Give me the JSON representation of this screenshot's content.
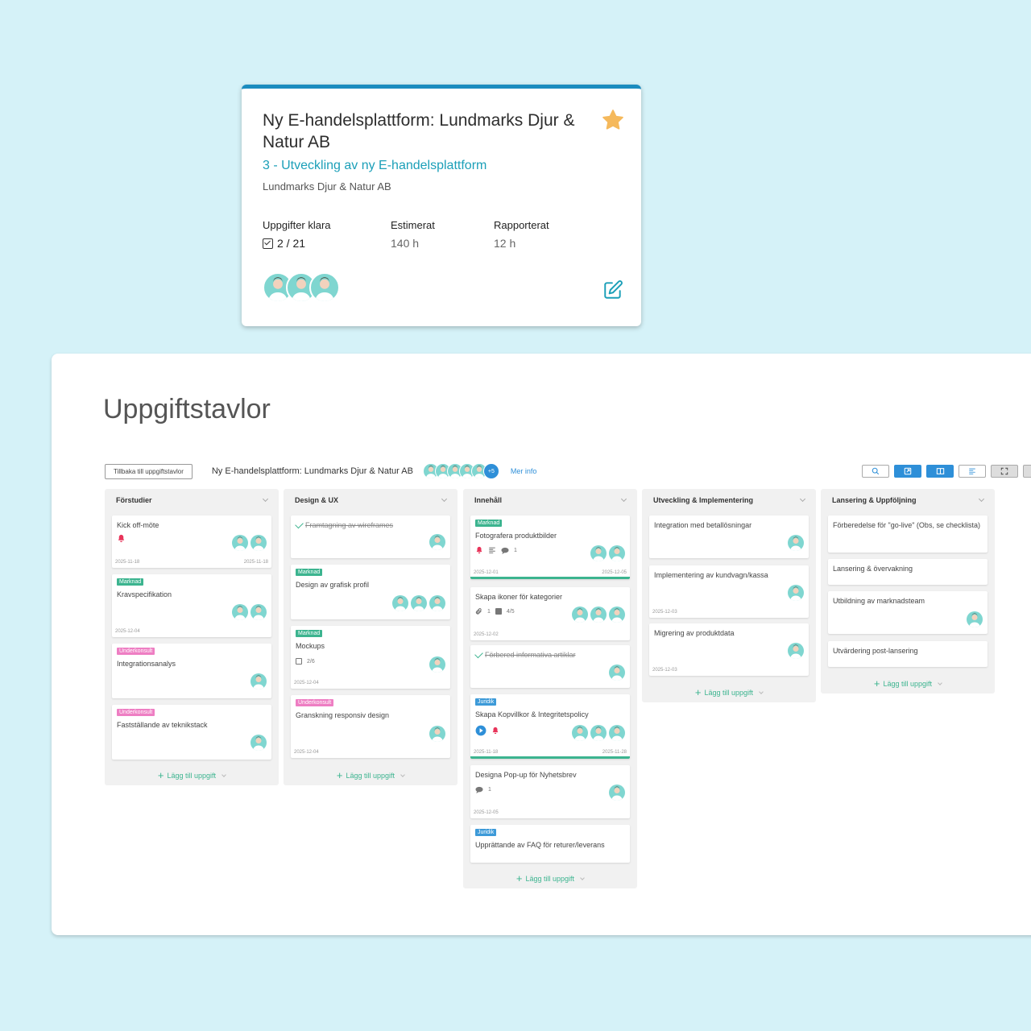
{
  "project_card": {
    "title": "Ny E-handelsplattform: Lundmarks Djur & Natur AB",
    "subtitle": "3 - Utveckling av ny E-handelsplattform",
    "client": "Lundmarks Djur & Natur AB",
    "stats": {
      "tasks_done_label": "Uppgifter klara",
      "tasks_done_value": "2 / 21",
      "estimated_label": "Estimerat",
      "estimated_value": "140 h",
      "reported_label": "Rapporterat",
      "reported_value": "12 h"
    },
    "icons": {
      "favorite": "star-icon",
      "edit": "edit-icon",
      "tasks": "checkbox-icon"
    },
    "colors": {
      "accent": "#1b8cbf",
      "star": "#f5b95c",
      "subtitle": "#1b9fb8"
    }
  },
  "board": {
    "page_title": "Uppgiftstavlor",
    "back_button": "Tillbaka till uppgiftstavlor",
    "board_name": "Ny E-handelsplattform: Lundmarks Djur & Natur AB",
    "more_members": "+5",
    "more_info": "Mer info",
    "add_task_label": "Lägg till uppgift",
    "toolbar_icons": [
      "search-icon",
      "external-link-icon",
      "board-view-icon",
      "list-view-icon",
      "fullscreen-icon",
      "details-icon"
    ],
    "columns": [
      {
        "name": "Förstudier",
        "tasks": [
          {
            "title": "Kick off-möte",
            "start": "2025-11-18",
            "end": "2025-11-18"
          },
          {
            "tag": "Marknad",
            "title": "Kravspecifikation",
            "end": "2025-12-04"
          },
          {
            "tag": "Underkonsult",
            "title": "Integrationsanalys"
          },
          {
            "tag": "Underkonsult",
            "title": "Fastställande av teknikstack"
          }
        ]
      },
      {
        "name": "Design & UX",
        "tasks": [
          {
            "title": "Framtagning av wireframes"
          },
          {
            "tag": "Marknad",
            "title": "Design av grafisk profil"
          },
          {
            "tag": "Marknad",
            "title": "Mockups",
            "checklist": "2/6",
            "end": "2025-12-04"
          },
          {
            "tag": "Underkonsult",
            "title": "Granskning responsiv design",
            "end": "2025-12-04"
          }
        ]
      },
      {
        "name": "Innehåll",
        "tasks": [
          {
            "tag": "Marknad",
            "title": "Fotografera produktbilder",
            "comments": "1",
            "start": "2025-12-01",
            "end": "2025-12-05"
          },
          {
            "title": "Skapa ikoner för kategorier",
            "attachments": "1",
            "checklist": "4/5",
            "end": "2025-12-02"
          },
          {
            "title": "Förbered informativa artiklar"
          },
          {
            "tag": "Juridik",
            "title": "Skapa Kopvillkor & Integritetspolicy",
            "start": "2025-11-18",
            "end": "2025-11-28"
          },
          {
            "title": "Designa Pop-up för Nyhetsbrev",
            "comments": "1",
            "end": "2025-12-05"
          },
          {
            "tag": "Juridik",
            "title": "Upprättande av FAQ för returer/leverans"
          }
        ]
      },
      {
        "name": "Utveckling & Implementering",
        "tasks": [
          {
            "title": "Integration med betallösningar"
          },
          {
            "title": "Implementering av kundvagn/kassa",
            "end": "2025-12-03"
          },
          {
            "title": "Migrering av produktdata",
            "end": "2025-12-03"
          }
        ]
      },
      {
        "name": "Lansering & Uppföljning",
        "tasks": [
          {
            "title": "Förberedelse för \"go-live\" (Obs, se checklista)"
          },
          {
            "title": "Lansering & övervakning"
          },
          {
            "title": "Utbildning av marknadsteam"
          },
          {
            "title": "Utvärdering post-lansering"
          }
        ]
      }
    ],
    "colors": {
      "tag_marknad": "#3cb48f",
      "tag_underkonsult": "#ee7ec3",
      "tag_juridik": "#3d9ad8",
      "progress": "#3cb48f",
      "primary_button": "#2e8fd8"
    }
  }
}
